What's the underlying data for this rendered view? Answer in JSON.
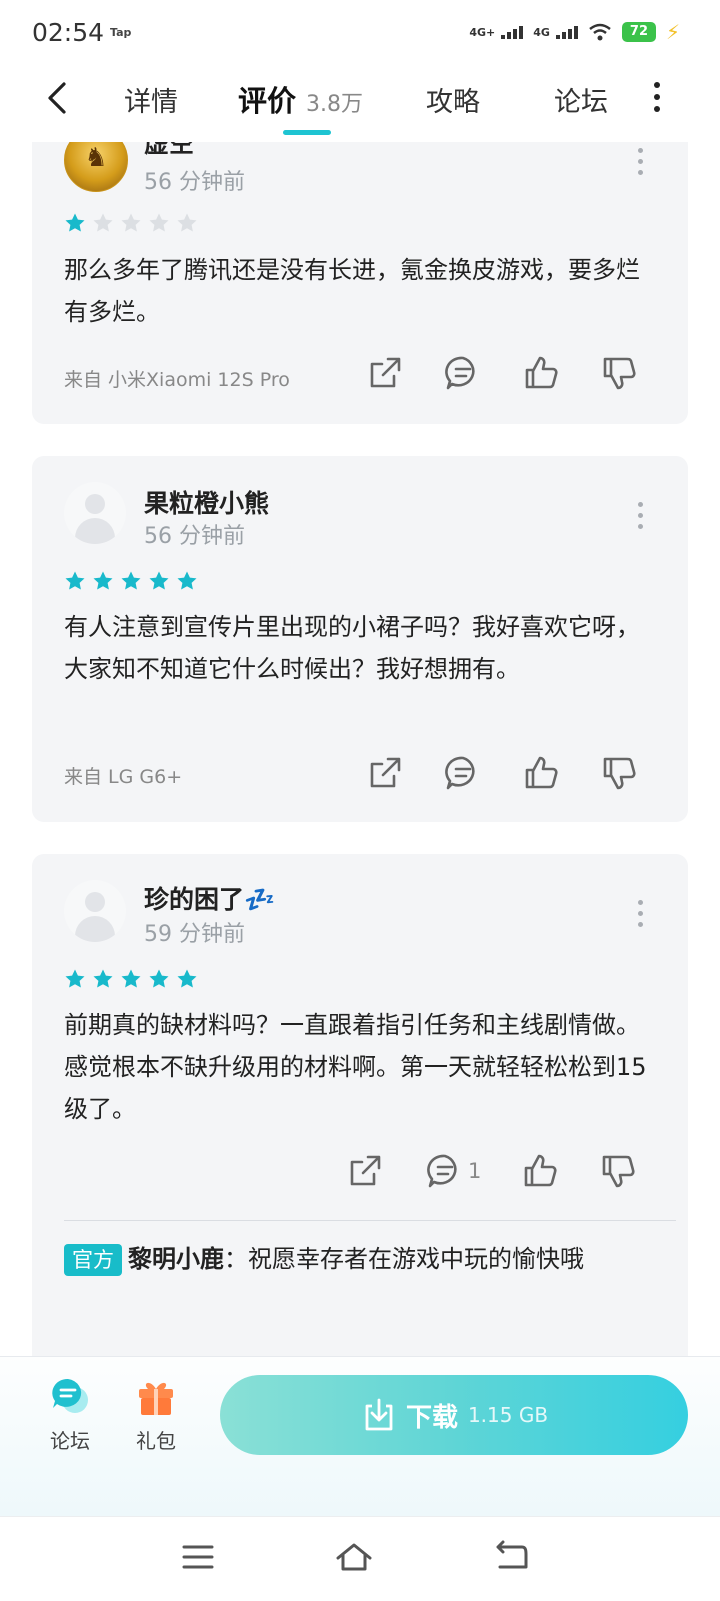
{
  "status": {
    "time": "02:54",
    "app_badge": "Tap",
    "signal1": "4G+",
    "signal2": "4G",
    "battery": "72"
  },
  "nav": {
    "tabs": [
      {
        "label": "详情"
      },
      {
        "label": "评价",
        "count": "3.8万"
      },
      {
        "label": "攻略"
      },
      {
        "label": "论坛"
      }
    ],
    "active_tab": "评价"
  },
  "reviews": [
    {
      "user": "虚空",
      "time": "56 分钟前",
      "rating": 1,
      "text": "那么多年了腾讯还是没有长进，氪金换皮游戏，要多烂有多烂。",
      "device": "来自 小米Xiaomi 12S Pro"
    },
    {
      "user": "果粒橙小熊",
      "time": "56 分钟前",
      "rating": 5,
      "text": "有人注意到宣传片里出现的小裙子吗？我好喜欢它呀，大家知不知道它什么时候出？我好想拥有。",
      "device": "来自 LG G6+"
    },
    {
      "user": "珍的困了💤",
      "time": "59 分钟前",
      "rating": 5,
      "text": "前期真的缺材料吗？一直跟着指引任务和主线剧情做。感觉根本不缺升级用的材料啊。第一天就轻轻松松到15级了。",
      "device": "",
      "comment_count": "1",
      "reply": {
        "badge": "官方",
        "author": "黎明小鹿",
        "separator": "：",
        "text": "祝愿幸存者在游戏中玩的愉快哦"
      }
    }
  ],
  "bottom": {
    "forum_label": "论坛",
    "gift_label": "礼包",
    "download_label": "下载",
    "download_size": "1.15 GB"
  },
  "colors": {
    "accent": "#1ec4d2",
    "star_on": "#18b9cb",
    "star_off": "#dcdfe3",
    "card_bg": "#f4f5f7"
  }
}
